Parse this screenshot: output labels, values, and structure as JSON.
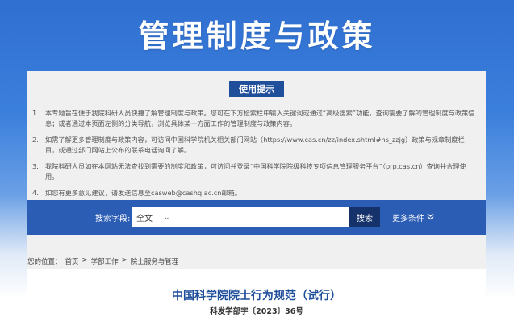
{
  "header": {
    "title": "管理制度与政策"
  },
  "tips": {
    "button_label": "使用提示",
    "items": [
      {
        "num": "1.",
        "text": "本专题旨在便于我院科研人员快捷了解管理制度与政策。您可在下方检索栏中输入关键词或通过“高级搜索”功能，查询需要了解的管理制度与政策信息；或者通过本页面左侧的分类导航，浏览具体某一方面工作的管理制度与政策内容。"
      },
      {
        "num": "2.",
        "text": "如需了解更多管理制度与政策内容，可访问中国科学院机关相关部门网站（https://www.cas.cn/zz/index.shtml#hs_zzjg）政策与规章制度栏目，或通过部门网站上公布的联系电话询问了解。"
      },
      {
        "num": "3.",
        "text": "我院科研人员如在本网站无法查找到需要的制度和政策，可访问并登录“中国科学院院级科技专项信息管理服务平台”（prp.cas.cn）查询并合理使用。"
      },
      {
        "num": "4.",
        "text": "如您有更多意见建议，请发送信息至casweb@cashq.ac.cn邮箱。"
      }
    ]
  },
  "search": {
    "label": "搜索字段:",
    "field_value": "全文",
    "button_label": "搜索",
    "more_label": "更多条件"
  },
  "breadcrumb": {
    "prefix": "您的位置：",
    "items": [
      "首页",
      "学部工作",
      "院士服务与管理"
    ],
    "separator": ">"
  },
  "document": {
    "title": "中国科学院院士行为规范（试行）",
    "number": "科发学部字〔2023〕36号"
  }
}
